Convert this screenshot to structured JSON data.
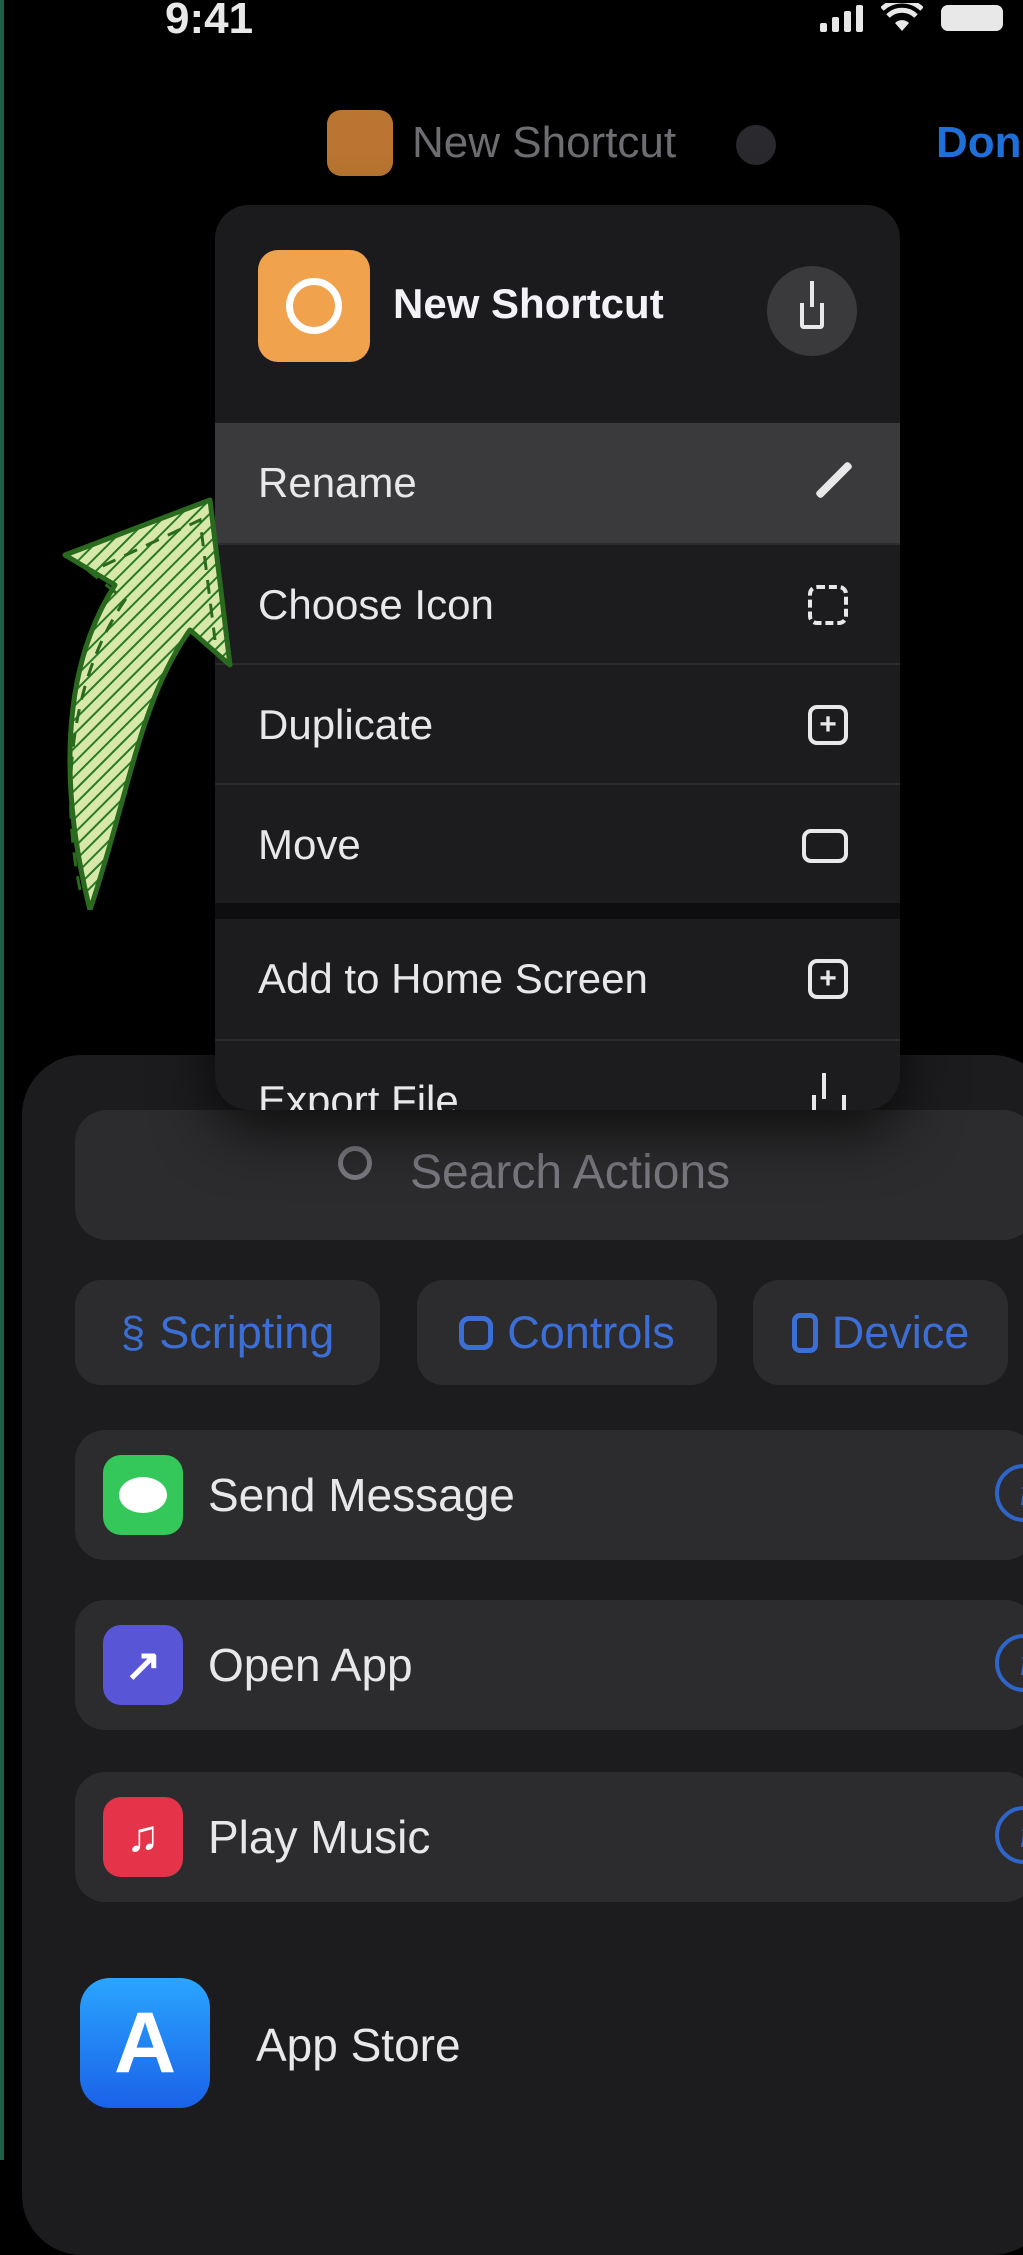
{
  "status_bar": {
    "time": "9:41"
  },
  "nav": {
    "title": "New Shortcut",
    "done_label": "Don"
  },
  "menu": {
    "title": "New Shortcut",
    "items": [
      {
        "label": "Rename",
        "icon": "pencil-icon",
        "highlighted": true
      },
      {
        "label": "Choose Icon",
        "icon": "dashed-square-icon"
      },
      {
        "label": "Duplicate",
        "icon": "duplicate-icon"
      },
      {
        "label": "Move",
        "icon": "folder-icon"
      },
      {
        "label": "Add to Home Screen",
        "icon": "plus-square-icon"
      },
      {
        "label": "Export File",
        "icon": "share-icon"
      }
    ]
  },
  "sheet": {
    "search_placeholder": "Search Actions",
    "categories": [
      {
        "label": "Scripting",
        "icon": "scripting-icon"
      },
      {
        "label": "Controls",
        "icon": "controls-icon"
      },
      {
        "label": "Device",
        "icon": "device-icon"
      }
    ],
    "actions": [
      {
        "label": "Send Message",
        "icon": "messages-icon",
        "color": "#34c759"
      },
      {
        "label": "Open App",
        "icon": "open-app-icon",
        "color": "#5856d6"
      },
      {
        "label": "Play Music",
        "icon": "music-icon",
        "color": "#e5344a"
      }
    ],
    "app_store": {
      "label": "App Store",
      "icon": "app-store-icon"
    }
  },
  "colors": {
    "accent": "#3c6fd6",
    "shortcut_icon": "#f0a24c",
    "arrow": "#d8e8a8"
  }
}
